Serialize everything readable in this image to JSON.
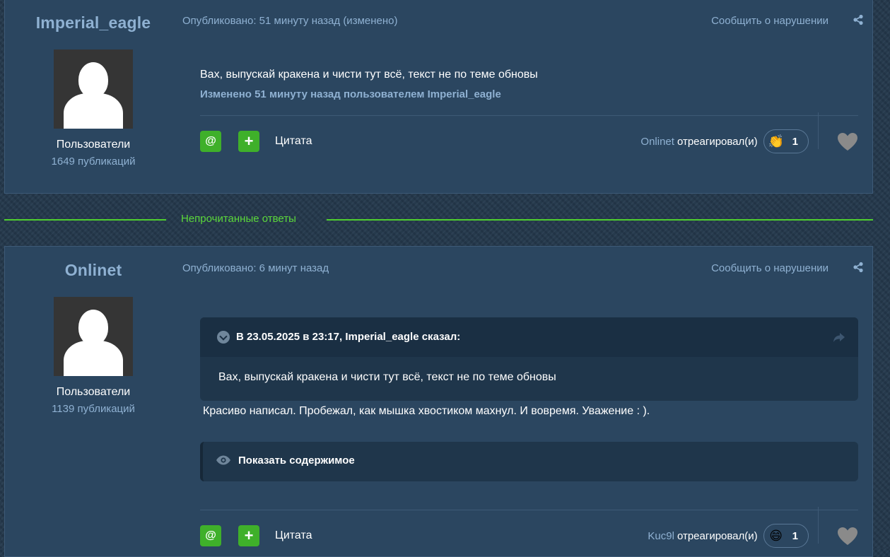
{
  "posts": [
    {
      "author": "Imperial_eagle",
      "group": "Пользователи",
      "post_count": "1649 публикаций",
      "meta": "Опубликовано: 51 минуту назад (изменено)",
      "report": "Сообщить о нарушении",
      "body": "Вах, выпускай кракена и чисти тут всё, текст не по теме обновы",
      "edit_note": "Изменено 51 минуту назад пользователем Imperial_eagle",
      "mention_icon": "@",
      "plus_icon": "+",
      "quote_label": "Цитата",
      "reaction_user": "Onlinet",
      "reaction_verb": "отреагировал(и)",
      "reaction_emoji": "👏",
      "reaction_count": "1"
    },
    {
      "author": "Onlinet",
      "group": "Пользователи",
      "post_count": "1139 публикаций",
      "meta": "Опубликовано: 6 минут назад",
      "report": "Сообщить о нарушении",
      "quote_title": "В 23.05.2025 в 23:17, Imperial_eagle сказал:",
      "quote_text": "Вах, выпускай кракена и чисти тут всё, текст не по теме обновы",
      "body": "Красиво написал. Пробежал, как мышка хвостиком махнул. И вовремя. Уважение : ).",
      "spoiler_label": "Показать содержимое",
      "mention_icon": "@",
      "plus_icon": "+",
      "quote_label": "Цитата",
      "reaction_user": "Kuc9l",
      "reaction_verb": "отреагировал(и)",
      "reaction_emoji": "😄",
      "reaction_count": "1"
    }
  ],
  "unread_divider": "Непрочитанные ответы",
  "colors": {
    "accent_green": "#3fb02a",
    "link_blue": "#8fb1d2",
    "post_bg": "#2b4660"
  },
  "icons": [
    "share-icon",
    "heart-icon",
    "chevron-down-icon",
    "eye-icon",
    "goto-arrow-icon",
    "avatar-placeholder-icon"
  ]
}
